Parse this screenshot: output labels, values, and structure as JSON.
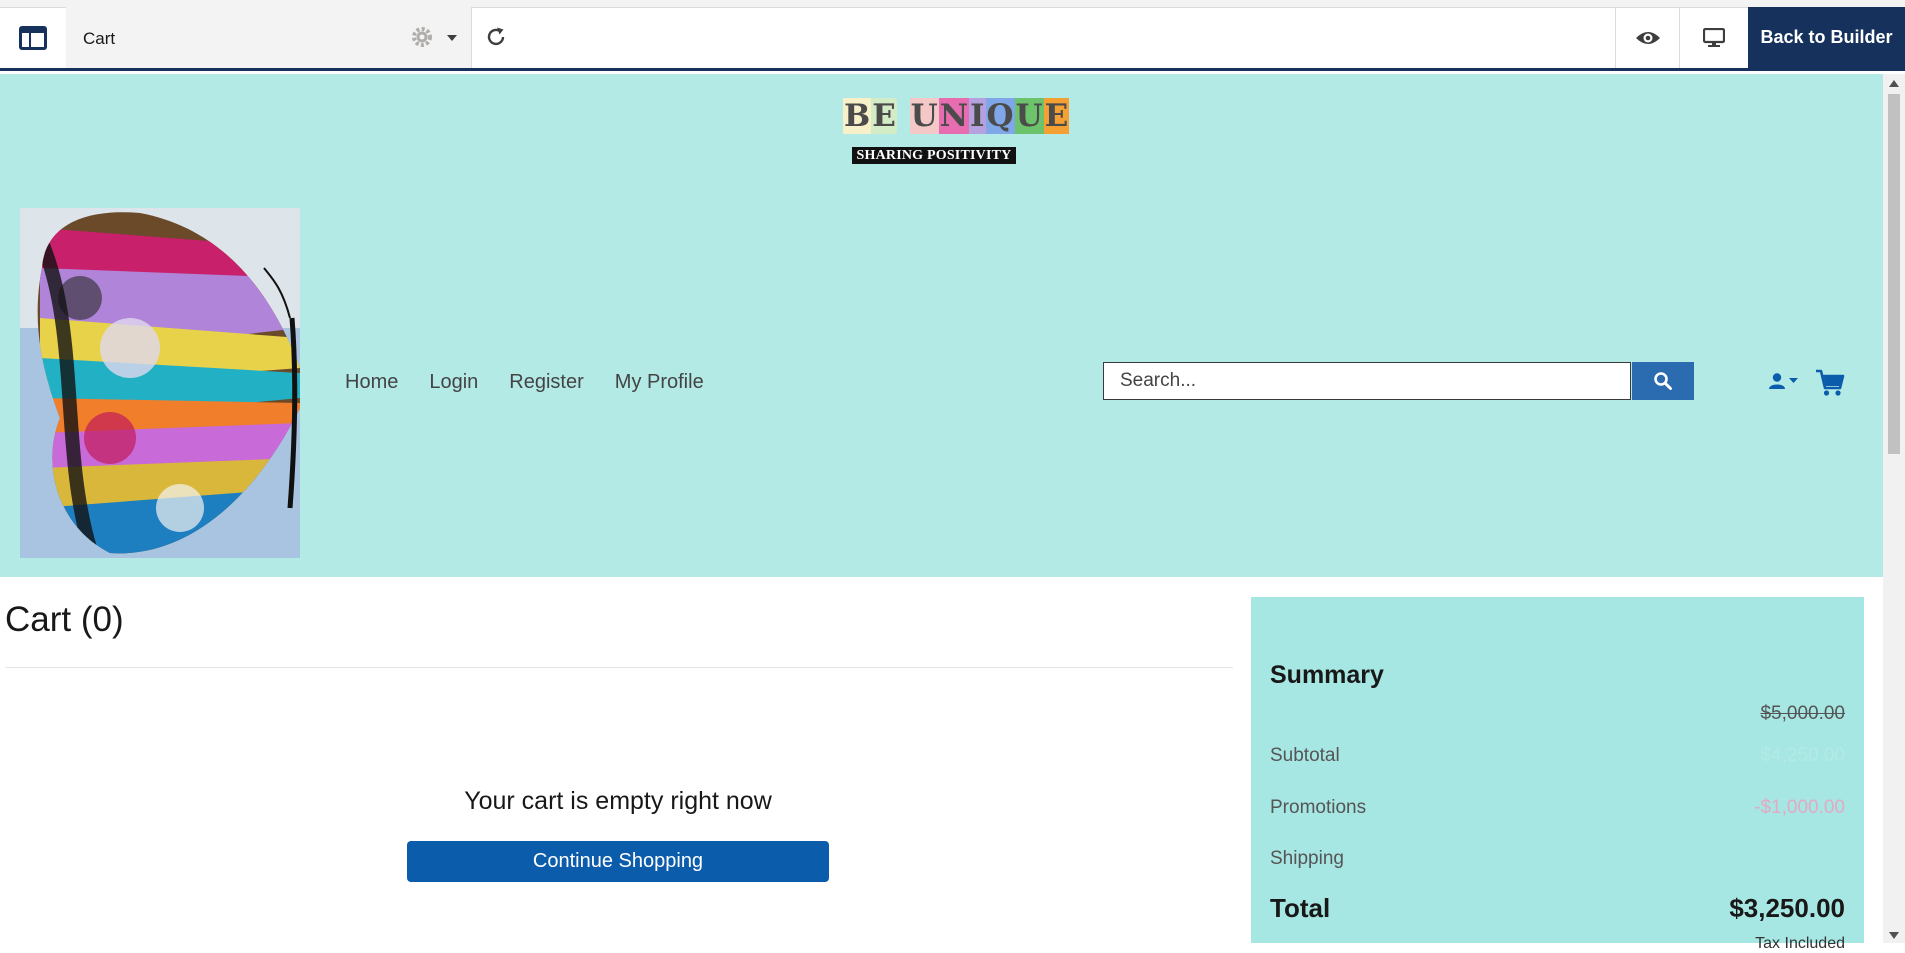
{
  "toolbar": {
    "page_name": "Cart",
    "back_label": "Back to Builder"
  },
  "header": {
    "logo_letters": [
      "B",
      "E",
      " ",
      "U",
      "N",
      "I",
      "Q",
      "U",
      "E"
    ],
    "logo_colors": [
      "#f7f0c8",
      "#d4ecc5",
      "#b3eae6",
      "#f5c8c8",
      "#e86db0",
      "#b6a1e0",
      "#7ea6e8",
      "#6cc36c",
      "#f5a033"
    ],
    "tagline": "SHARING POSITIVITY",
    "nav": [
      "Home",
      "Login",
      "Register",
      "My Profile"
    ],
    "search_placeholder": "Search..."
  },
  "cart": {
    "title": "Cart (0)",
    "empty_message": "Your cart is empty right now",
    "continue_label": "Continue Shopping"
  },
  "summary": {
    "title": "Summary",
    "original_price": "$5,000.00",
    "subtotal_label": "Subtotal",
    "subtotal_value": "$4,250.00",
    "promotions_label": "Promotions",
    "promotions_value": "-$1,000.00",
    "shipping_label": "Shipping",
    "total_label": "Total",
    "total_value": "$3,250.00",
    "tax_note": "Tax Included"
  },
  "colors": {
    "header_bg": "#b3eae6",
    "summary_bg": "#a6e6e3",
    "brand_dark": "#16325c",
    "button_blue": "#0b5cab",
    "search_blue": "#2b6cb0",
    "promo_pink": "#e4a9c4"
  }
}
